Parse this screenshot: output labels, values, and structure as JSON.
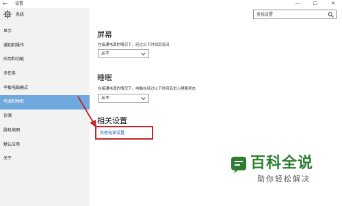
{
  "window": {
    "back_glyph": "←",
    "title": "设置",
    "minimize_glyph": "—",
    "maximize_glyph": "☐",
    "close_glyph": "✕"
  },
  "sidebar": {
    "header": "系统",
    "items": [
      {
        "label": "显示"
      },
      {
        "label": "通知和操作"
      },
      {
        "label": "应用和功能"
      },
      {
        "label": "多任务"
      },
      {
        "label": "平板电脑模式"
      },
      {
        "label": "电源和睡眠",
        "active": true
      },
      {
        "label": "存储"
      },
      {
        "label": "脱机地图"
      },
      {
        "label": "默认应用"
      },
      {
        "label": "关于"
      }
    ]
  },
  "search": {
    "placeholder": "查找设置"
  },
  "screen": {
    "title": "屏幕",
    "description": "在接通电源的情况下，经过以下时间后关闭",
    "value": "从不"
  },
  "sleep": {
    "title": "睡眠",
    "description": "在接通电源的情况下，电脑在经过以下时间后进入睡眠状态",
    "value": "从不"
  },
  "related": {
    "title": "相关设置",
    "link": "其他电源设置"
  },
  "watermark": {
    "main": "百科全说",
    "sub": "助你轻松解决"
  },
  "colors": {
    "active_nav": "#6fa8dc",
    "highlight_box": "#c3262b",
    "link": "#1f5fb4",
    "watermark": "#2e7d32"
  }
}
